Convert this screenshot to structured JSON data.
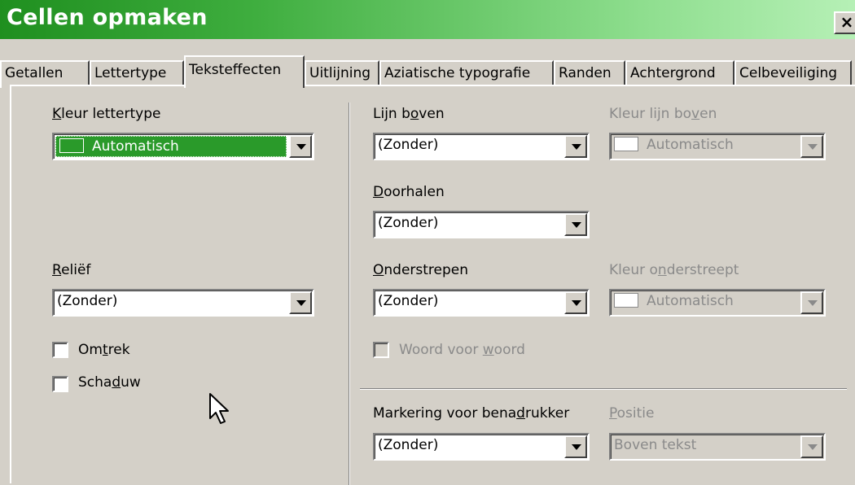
{
  "window": {
    "title": "Cellen opmaken",
    "close_label": "×"
  },
  "tabs": [
    {
      "label": "Getallen"
    },
    {
      "label": "Lettertype"
    },
    {
      "label": "Teksteffecten"
    },
    {
      "label": "Uitlijning"
    },
    {
      "label": "Aziatische typografie"
    },
    {
      "label": "Randen"
    },
    {
      "label": "Achtergrond"
    },
    {
      "label": "Celbeveiliging"
    }
  ],
  "active_tab": "Teksteffecten",
  "left": {
    "font_color": {
      "label_key": "K",
      "label_rest": "leur lettertype",
      "value": "Automatisch"
    },
    "relief": {
      "label_key": "R",
      "label_rest": "eliëf",
      "value": "(Zonder)"
    },
    "outline": {
      "label_pre": "Om",
      "label_key": "t",
      "label_post": "rek",
      "checked": false
    },
    "shadow": {
      "label_pre": "Scha",
      "label_key": "d",
      "label_post": "uw",
      "checked": false
    }
  },
  "right": {
    "overline": {
      "label_pre": "Lijn b",
      "label_key": "o",
      "label_post": "ven",
      "value": "(Zonder)"
    },
    "overline_color": {
      "label_pre": "Kleur lijn bo",
      "label_key": "v",
      "label_post": "en",
      "value": "Automatisch"
    },
    "strikethrough": {
      "label_key": "D",
      "label_rest": "oorhalen",
      "value": "(Zonder)"
    },
    "underline": {
      "label_key": "O",
      "label_rest": "nderstrepen",
      "value": "(Zonder)"
    },
    "underline_color": {
      "label_pre": "Kleur o",
      "label_key": "n",
      "label_post": "derstreept",
      "value": "Automatisch"
    },
    "word_by_word": {
      "label_pre": "Woord voor ",
      "label_key": "w",
      "label_post": "oord",
      "checked": false
    },
    "emphasis": {
      "label_pre": "Markering voor bena",
      "label_key": "d",
      "label_post": "rukker",
      "value": "(Zonder)"
    },
    "position": {
      "label_key": "P",
      "label_rest": "ositie",
      "value": "Boven tekst"
    }
  },
  "colors": {
    "accent": "#2a9a2a",
    "face": "#d4d0c8"
  }
}
